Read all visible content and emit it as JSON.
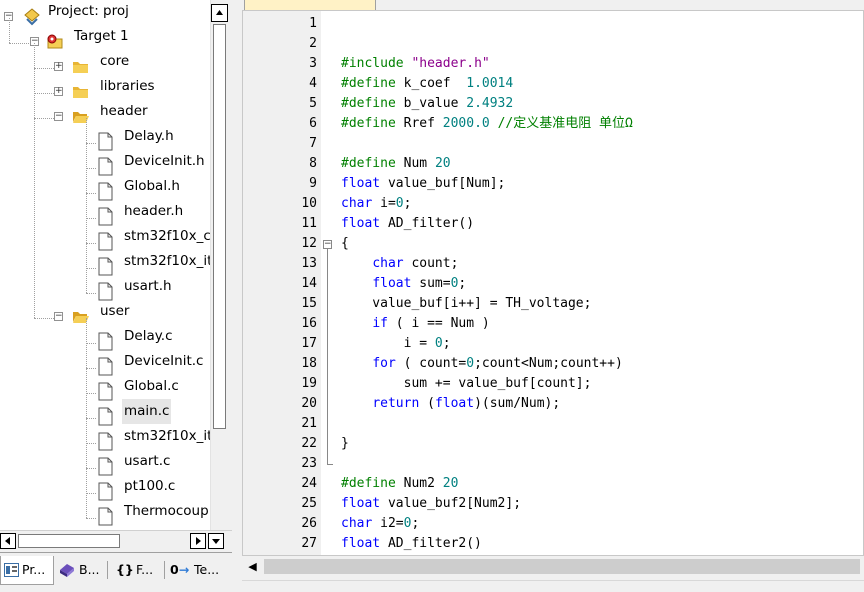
{
  "project_tree": {
    "project": "Project: proj",
    "target": "Target 1",
    "groups": [
      {
        "label": "core",
        "expanded": false,
        "files": []
      },
      {
        "label": "libraries",
        "expanded": false,
        "files": []
      },
      {
        "label": "header",
        "expanded": true,
        "files": [
          "Delay.h",
          "DeviceInit.h",
          "Global.h",
          "header.h",
          "stm32f10x_c",
          "stm32f10x_it",
          "usart.h"
        ]
      },
      {
        "label": "user",
        "expanded": true,
        "files": [
          "Delay.c",
          "DeviceInit.c",
          "Global.c",
          "main.c",
          "stm32f10x_it",
          "usart.c",
          "pt100.c",
          "Thermocoup"
        ]
      }
    ],
    "selected_file": "main.c"
  },
  "panel_tabs": [
    {
      "icon": "project-tab-icon",
      "label": "Pr...",
      "active": true
    },
    {
      "icon": "books-tab-icon",
      "label": "B...",
      "active": false
    },
    {
      "icon": "functions-tab-icon",
      "label": "F...",
      "active": false
    },
    {
      "icon": "templates-tab-icon",
      "label": "Te...",
      "active": false
    }
  ],
  "editor": {
    "line_numbers": [
      "1",
      "2",
      "3",
      "4",
      "5",
      "6",
      "7",
      "8",
      "9",
      "10",
      "11",
      "12",
      "13",
      "14",
      "15",
      "16",
      "17",
      "18",
      "19",
      "20",
      "21",
      "22",
      "23",
      "24",
      "25",
      "26",
      "27"
    ],
    "lines": [
      [],
      [],
      [
        [
          "pp",
          "#include "
        ],
        [
          "str",
          "\"header.h\""
        ]
      ],
      [
        [
          "pp",
          "#define "
        ],
        [
          "plain",
          "k_coef  "
        ],
        [
          "num",
          "1.0014"
        ]
      ],
      [
        [
          "pp",
          "#define "
        ],
        [
          "plain",
          "b_value "
        ],
        [
          "num",
          "2.4932"
        ]
      ],
      [
        [
          "pp",
          "#define "
        ],
        [
          "plain",
          "Rref "
        ],
        [
          "num",
          "2000.0 "
        ],
        [
          "cm",
          "//定义基准电阻 单位Ω"
        ]
      ],
      [],
      [
        [
          "pp",
          "#define "
        ],
        [
          "plain",
          "Num "
        ],
        [
          "num",
          "20"
        ]
      ],
      [
        [
          "kw",
          "float "
        ],
        [
          "plain",
          "value_buf[Num];"
        ]
      ],
      [
        [
          "kw",
          "char "
        ],
        [
          "plain",
          "i="
        ],
        [
          "num",
          "0"
        ],
        [
          "plain",
          ";"
        ]
      ],
      [
        [
          "kw",
          "float "
        ],
        [
          "plain",
          "AD_filter()"
        ]
      ],
      [
        [
          "plain",
          "{"
        ]
      ],
      [
        [
          "plain",
          "    "
        ],
        [
          "kw",
          "char "
        ],
        [
          "plain",
          "count;"
        ]
      ],
      [
        [
          "plain",
          "    "
        ],
        [
          "kw",
          "float "
        ],
        [
          "plain",
          "sum="
        ],
        [
          "num",
          "0"
        ],
        [
          "plain",
          ";"
        ]
      ],
      [
        [
          "plain",
          "    value_buf[i++] = TH_voltage;"
        ]
      ],
      [
        [
          "plain",
          "    "
        ],
        [
          "kw",
          "if "
        ],
        [
          "plain",
          "( i == Num )"
        ]
      ],
      [
        [
          "plain",
          "        i = "
        ],
        [
          "num",
          "0"
        ],
        [
          "plain",
          ";"
        ]
      ],
      [
        [
          "plain",
          "    "
        ],
        [
          "kw",
          "for "
        ],
        [
          "plain",
          "( count="
        ],
        [
          "num",
          "0"
        ],
        [
          "plain",
          ";count<Num;count++)"
        ]
      ],
      [
        [
          "plain",
          "        sum += value_buf[count];"
        ]
      ],
      [
        [
          "plain",
          "    "
        ],
        [
          "kw",
          "return "
        ],
        [
          "plain",
          "("
        ],
        [
          "kw",
          "float"
        ],
        [
          "plain",
          ")(sum/Num);"
        ]
      ],
      [],
      [
        [
          "plain",
          "}"
        ]
      ],
      [],
      [
        [
          "pp",
          "#define "
        ],
        [
          "plain",
          "Num2 "
        ],
        [
          "num",
          "20"
        ]
      ],
      [
        [
          "kw",
          "float "
        ],
        [
          "plain",
          "value_buf2[Num2];"
        ]
      ],
      [
        [
          "kw",
          "char "
        ],
        [
          "plain",
          "i2="
        ],
        [
          "num",
          "0"
        ],
        [
          "plain",
          ";"
        ]
      ],
      [
        [
          "kw",
          "float "
        ],
        [
          "plain",
          "AD_filter2()"
        ]
      ]
    ],
    "colors": {
      "keyword": "#0000ff",
      "preprocessor": "#008000",
      "string": "#8b008b",
      "number": "#008080",
      "comment": "#008000",
      "background": "#ffffff",
      "gutter": "#f0f0f0"
    }
  }
}
